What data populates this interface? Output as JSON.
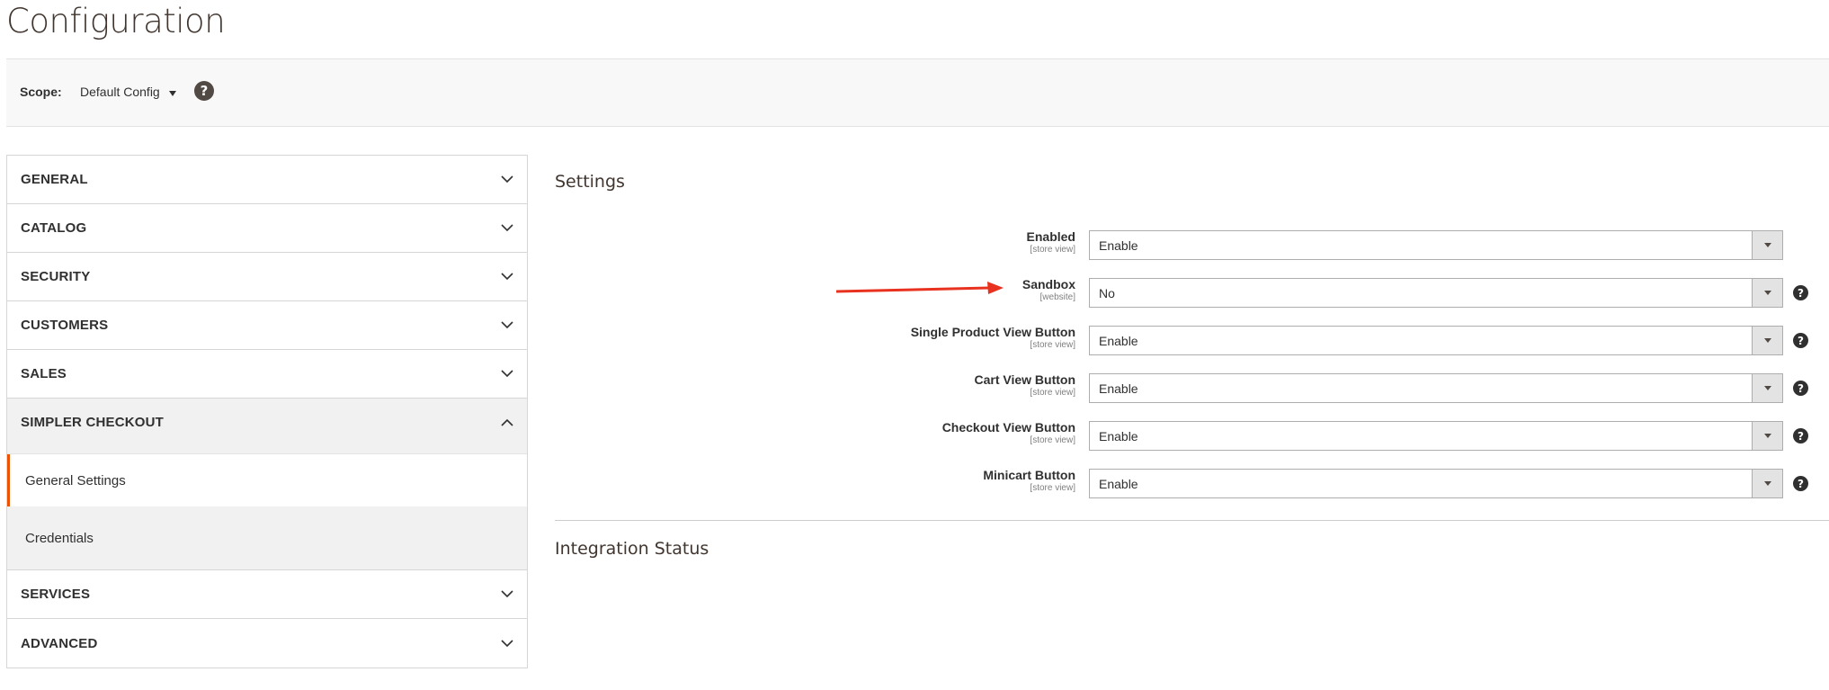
{
  "page": {
    "title": "Configuration"
  },
  "scope": {
    "label": "Scope:",
    "value": "Default Config"
  },
  "sidebar": {
    "sections_top": [
      {
        "label": "GENERAL"
      },
      {
        "label": "CATALOG"
      },
      {
        "label": "SECURITY"
      },
      {
        "label": "CUSTOMERS"
      },
      {
        "label": "SALES"
      }
    ],
    "open_section": {
      "label": "SIMPLER CHECKOUT",
      "items": [
        {
          "label": "General Settings",
          "active": true
        },
        {
          "label": "Credentials",
          "active": false
        }
      ]
    },
    "sections_bottom": [
      {
        "label": "SERVICES"
      },
      {
        "label": "ADVANCED"
      }
    ]
  },
  "main": {
    "settings_title": "Settings",
    "integration_title": "Integration Status",
    "fields": [
      {
        "label": "Enabled",
        "scope": "[store view]",
        "value": "Enable",
        "help": false
      },
      {
        "label": "Sandbox",
        "scope": "[website]",
        "value": "No",
        "help": true
      },
      {
        "label": "Single Product View Button",
        "scope": "[store view]",
        "value": "Enable",
        "help": true
      },
      {
        "label": "Cart View Button",
        "scope": "[store view]",
        "value": "Enable",
        "help": true
      },
      {
        "label": "Checkout View Button",
        "scope": "[store view]",
        "value": "Enable",
        "help": true
      },
      {
        "label": "Minicart Button",
        "scope": "[store view]",
        "value": "Enable",
        "help": true
      }
    ]
  },
  "colors": {
    "accent": "#eb5202",
    "annotation_arrow": "#e8321f",
    "help_icon": "#514943"
  },
  "icons": {
    "help": "?"
  }
}
